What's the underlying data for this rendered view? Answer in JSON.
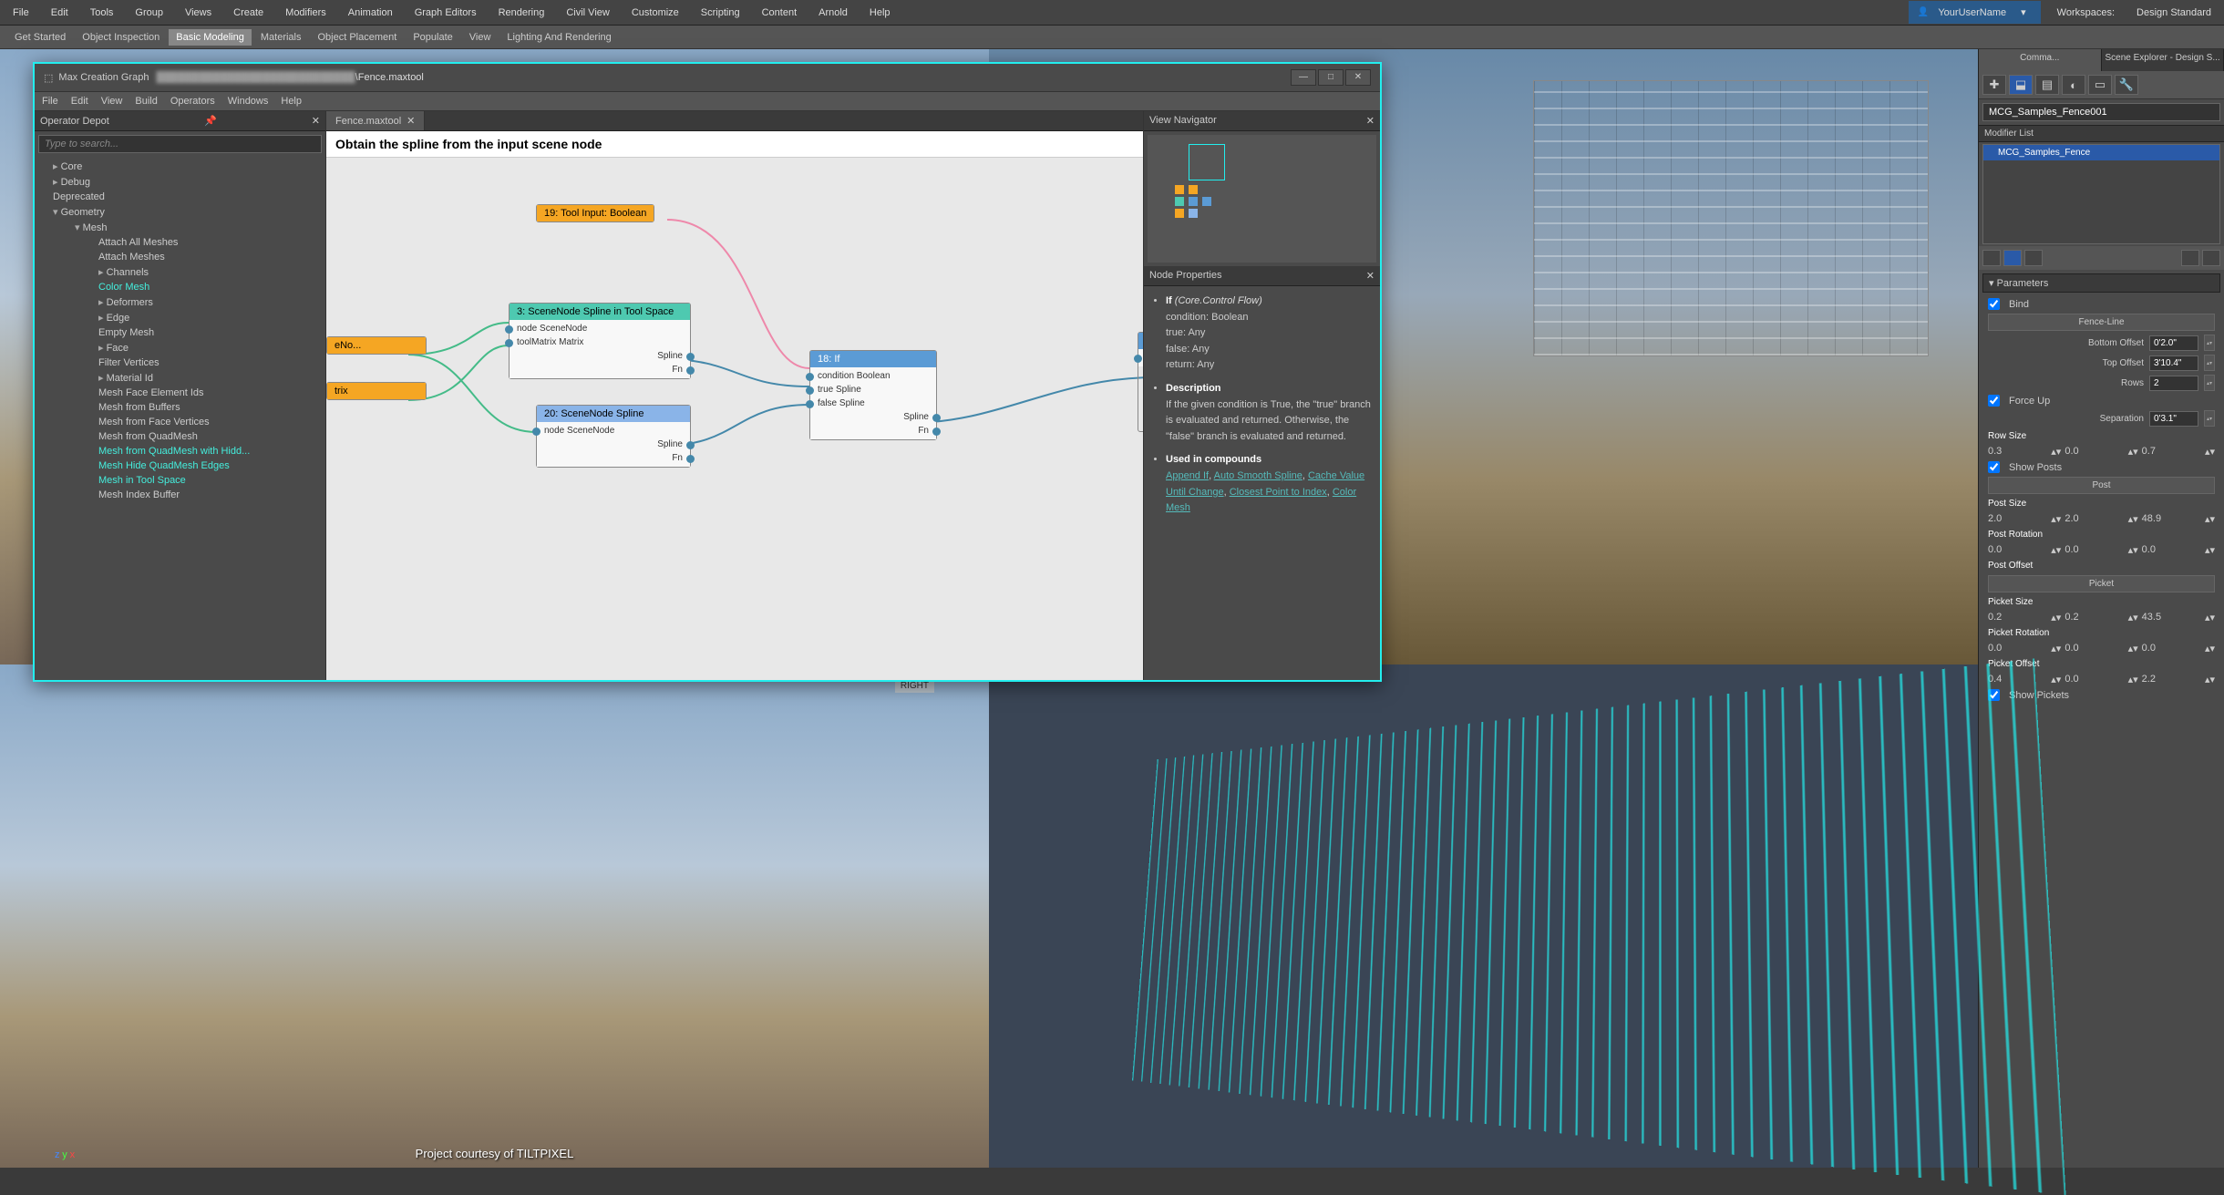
{
  "menubar": [
    "File",
    "Edit",
    "Tools",
    "Group",
    "Views",
    "Create",
    "Modifiers",
    "Animation",
    "Graph Editors",
    "Rendering",
    "Civil View",
    "Customize",
    "Scripting",
    "Content",
    "Arnold",
    "Help"
  ],
  "user": "YourUserName",
  "workspaces_label": "Workspaces:",
  "workspace": "Design Standard",
  "toolbar": [
    "Get Started",
    "Object Inspection",
    "Basic Modeling",
    "Materials",
    "Object Placement",
    "Populate",
    "View",
    "Lighting And Rendering"
  ],
  "toolbar_active": 2,
  "mcg": {
    "title_prefix": "Max Creation Graph",
    "path_suffix": "\\Fence.maxtool",
    "menus": [
      "File",
      "Edit",
      "View",
      "Build",
      "Operators",
      "Windows",
      "Help"
    ],
    "depot_title": "Operator Depot",
    "search_placeholder": "Type to search...",
    "tree": [
      {
        "t": "Core",
        "c": "l1 exp"
      },
      {
        "t": "Debug",
        "c": "l1 exp"
      },
      {
        "t": "Deprecated",
        "c": "l1"
      },
      {
        "t": "Geometry",
        "c": "l1 expo"
      },
      {
        "t": "Mesh",
        "c": "l2 expo"
      },
      {
        "t": "Attach All Meshes",
        "c": "l3"
      },
      {
        "t": "Attach Meshes",
        "c": "l3"
      },
      {
        "t": "Channels",
        "c": "l3 exp"
      },
      {
        "t": "Color Mesh",
        "c": "l3 hl"
      },
      {
        "t": "Deformers",
        "c": "l3 exp"
      },
      {
        "t": "Edge",
        "c": "l3 exp"
      },
      {
        "t": "Empty Mesh",
        "c": "l3"
      },
      {
        "t": "Face",
        "c": "l3 exp"
      },
      {
        "t": "Filter Vertices",
        "c": "l3"
      },
      {
        "t": "Material Id",
        "c": "l3 exp"
      },
      {
        "t": "Mesh Face Element Ids",
        "c": "l3"
      },
      {
        "t": "Mesh from Buffers",
        "c": "l3"
      },
      {
        "t": "Mesh from Face Vertices",
        "c": "l3"
      },
      {
        "t": "Mesh from QuadMesh",
        "c": "l3"
      },
      {
        "t": "Mesh from QuadMesh with Hidd...",
        "c": "l3 hl"
      },
      {
        "t": "Mesh Hide QuadMesh Edges",
        "c": "l3 hl"
      },
      {
        "t": "Mesh in Tool Space",
        "c": "l3 hl"
      },
      {
        "t": "Mesh Index Buffer",
        "c": "l3"
      }
    ],
    "doc_tab": "Fence.maxtool",
    "canvas_title": "Obtain the spline from the input scene node",
    "nodes": {
      "n19": {
        "title": "19: Tool Input: Boolean"
      },
      "n3": {
        "title": "3: SceneNode Spline in Tool Space",
        "ports_in": [
          "node SceneNode",
          "toolMatrix Matrix"
        ],
        "ports_out": [
          "Spline",
          "Fn"
        ]
      },
      "n20": {
        "title": "20: SceneNode Spline",
        "ports_in": [
          "node SceneNode"
        ],
        "ports_out": [
          "Spline",
          "Fn"
        ]
      },
      "n18": {
        "title": "18: If",
        "ports_in": [
          "condition Boolean",
          "true Spline",
          "false Spline"
        ],
        "ports_out": [
          "Spline",
          "Fn"
        ]
      },
      "stubA": {
        "title": "eNo..."
      },
      "stubB": {
        "title": "trix"
      }
    },
    "nav_title": "View Navigator",
    "props_title": "Node Properties",
    "props": {
      "sig_title": "If",
      "sig_cat": "(Core.Control Flow)",
      "rows": [
        "condition: Boolean",
        "true: Any",
        "false: Any",
        "return: Any"
      ],
      "desc_h": "Description",
      "desc": "If the given condition is True, the \"true\" branch is evaluated and returned. Otherwise, the \"false\" branch is evaluated and returned.",
      "used_h": "Used in compounds",
      "links": [
        "Append If",
        "Auto Smooth Spline",
        "Cache Value Until Change",
        "Closest Point to Index",
        "Color Mesh"
      ]
    }
  },
  "viewport": {
    "right_label": "RIGHT",
    "credit": "Project courtesy of TILTPIXEL"
  },
  "cmd": {
    "tabs": [
      "Comma...",
      "Scene Explorer - Design S..."
    ],
    "obj_name": "MCG_Samples_Fence001",
    "modlist": "Modifier List",
    "mod_sel": "MCG_Samples_Fence",
    "rollout": "Parameters",
    "bind": "Bind",
    "fence_line": "Fence-Line",
    "bottom_offset_l": "Bottom Offset",
    "bottom_offset": "0'2.0\"",
    "top_offset_l": "Top Offset",
    "top_offset": "3'10.4\"",
    "rows_l": "Rows",
    "rows": "2",
    "forceup": "Force Up",
    "sep_l": "Separation",
    "sep": "0'3.1\"",
    "rowsize_h": "Row Size",
    "rowsize": [
      "0.3",
      "0.0",
      "0.7"
    ],
    "showposts": "Show Posts",
    "post_btn": "Post",
    "postsize_h": "Post Size",
    "postsize": [
      "2.0",
      "2.0",
      "48.9"
    ],
    "postrot_h": "Post Rotation",
    "postrot": [
      "0.0",
      "0.0",
      "0.0"
    ],
    "postoff_h": "Post Offset",
    "picket_btn": "Picket",
    "picketsize_h": "Picket Size",
    "picketsize": [
      "0.2",
      "0.2",
      "43.5"
    ],
    "picketrot_h": "Picket Rotation",
    "picketrot": [
      "0.0",
      "0.0",
      "0.0"
    ],
    "picketoff_h": "Picket Offset",
    "picketoff": [
      "0.4",
      "0.0",
      "2.2"
    ],
    "showpickets": "Show Pickets"
  }
}
